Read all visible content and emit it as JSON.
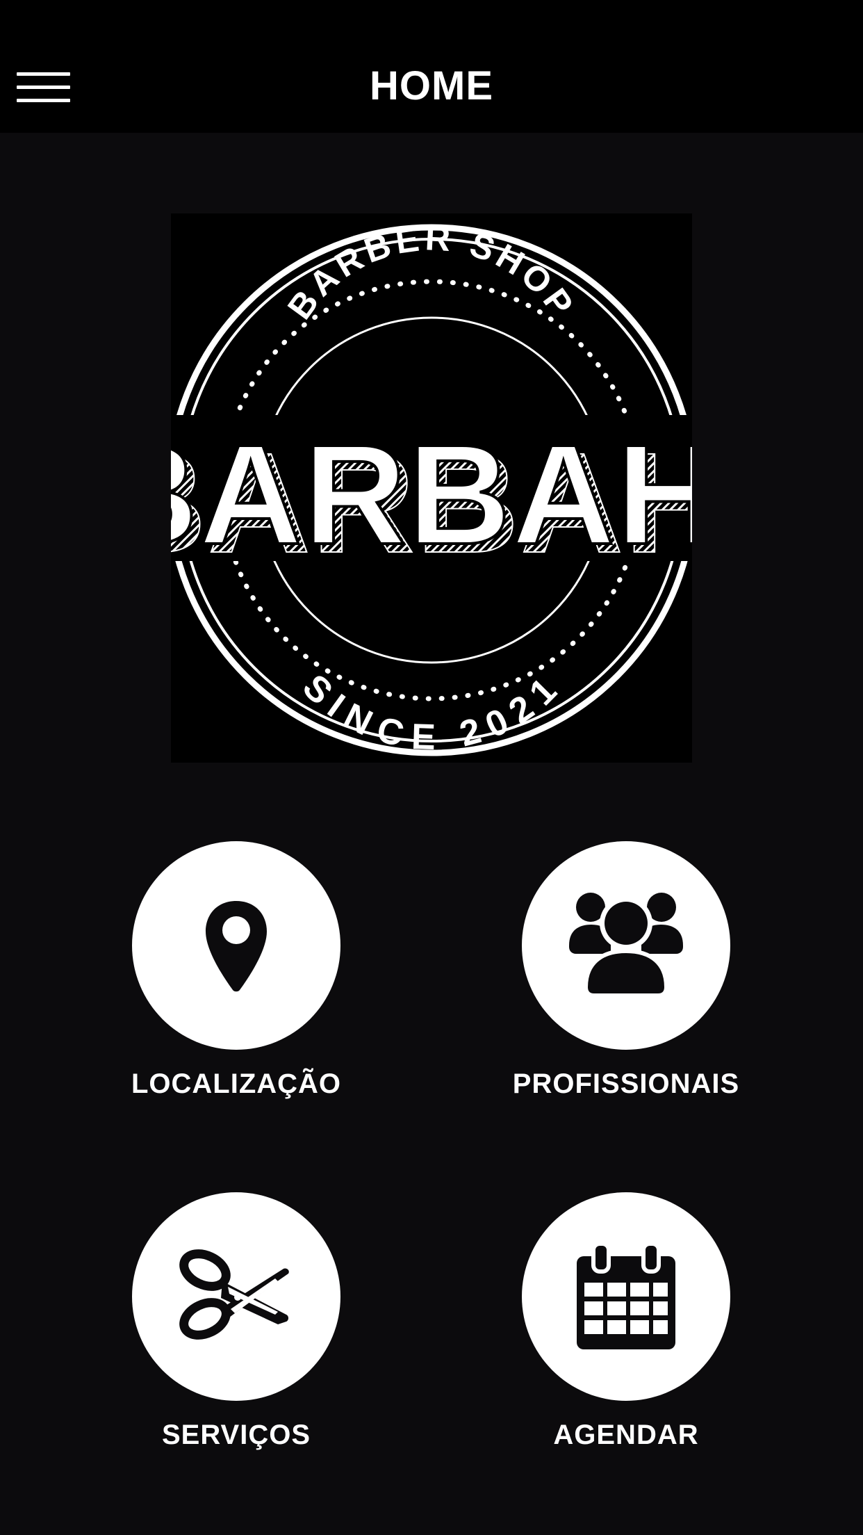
{
  "header": {
    "title": "HOME",
    "menu_icon": "hamburger-menu-icon"
  },
  "logo": {
    "top_text": "BARBER SHOP",
    "brand": "BARBAH!",
    "bottom_text": "SINCE 2021"
  },
  "tiles": [
    {
      "label": "LOCALIZAÇÃO",
      "icon": "map-pin-icon"
    },
    {
      "label": "PROFISSIONAIS",
      "icon": "users-group-icon"
    },
    {
      "label": "SERVIÇOS",
      "icon": "scissors-icon"
    },
    {
      "label": "AGENDAR",
      "icon": "calendar-icon"
    }
  ],
  "colors": {
    "background": "#0c0b0d",
    "header_background": "#000000",
    "foreground": "#ffffff"
  }
}
